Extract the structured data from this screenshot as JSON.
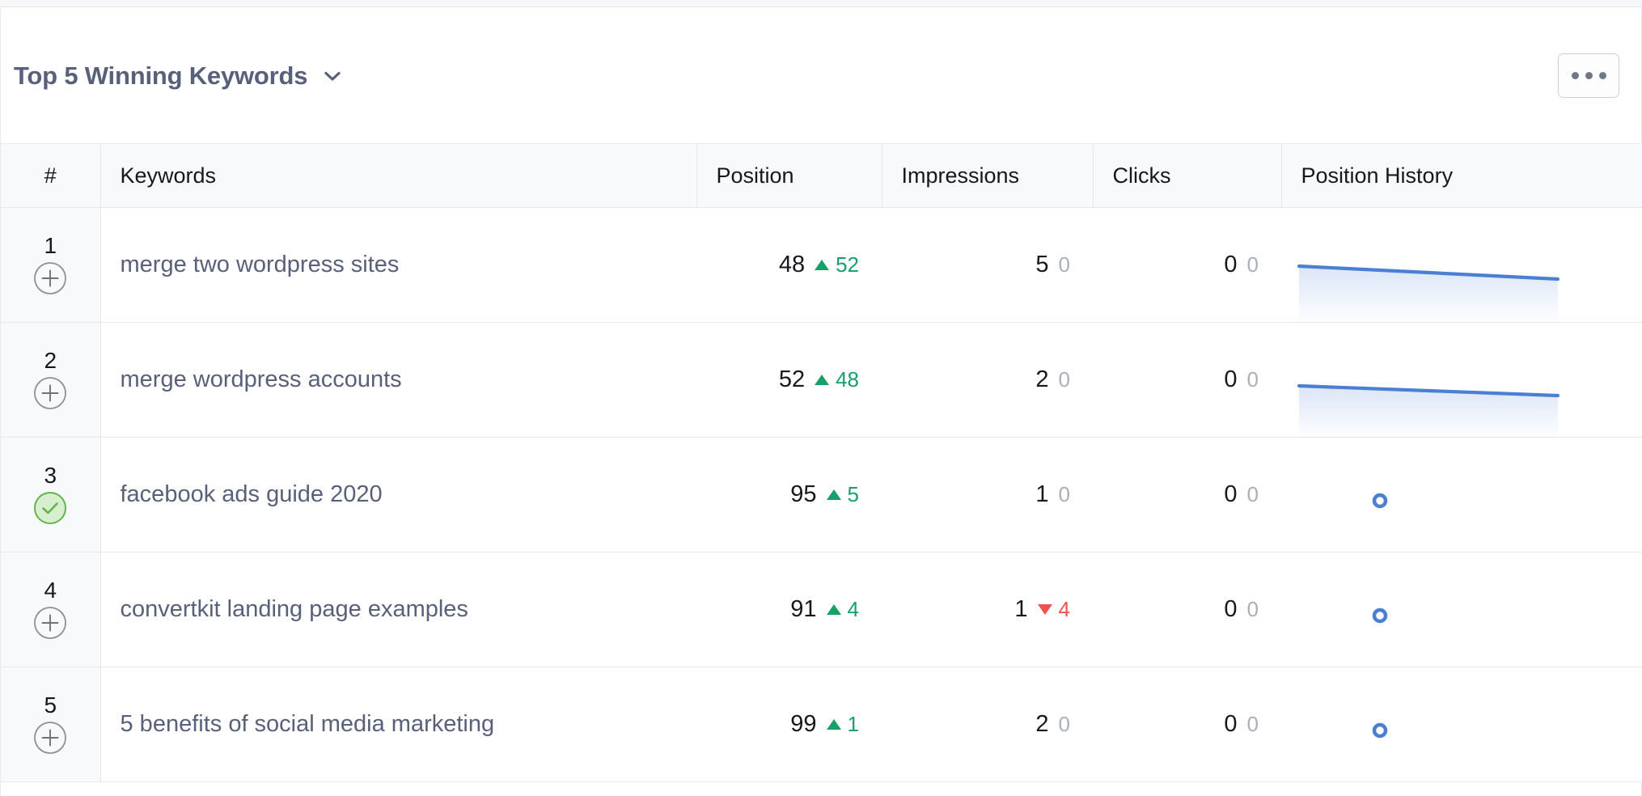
{
  "header": {
    "title": "Top 5 Winning Keywords",
    "dropdown_icon": "chevron-down-icon",
    "menu_button_label": "•••",
    "menu_button_icon": "ellipsis-icon"
  },
  "table": {
    "columns": [
      {
        "key": "num",
        "label": "#"
      },
      {
        "key": "kw",
        "label": "Keywords"
      },
      {
        "key": "pos",
        "label": "Position"
      },
      {
        "key": "impr",
        "label": "Impressions"
      },
      {
        "key": "clk",
        "label": "Clicks"
      },
      {
        "key": "hist",
        "label": "Position History"
      }
    ],
    "rows": [
      {
        "rank": "1",
        "action_icon": "plus-circle-icon",
        "action_state": "add",
        "keyword": "merge two wordpress sites",
        "position": "48",
        "position_delta": "52",
        "position_dir": "up",
        "impressions": "5",
        "impressions_delta": "0",
        "impressions_dir": "zero",
        "clicks": "0",
        "clicks_delta": "0",
        "clicks_dir": "zero",
        "history_type": "line"
      },
      {
        "rank": "2",
        "action_icon": "plus-circle-icon",
        "action_state": "add",
        "keyword": "merge wordpress accounts",
        "position": "52",
        "position_delta": "48",
        "position_dir": "up",
        "impressions": "2",
        "impressions_delta": "0",
        "impressions_dir": "zero",
        "clicks": "0",
        "clicks_delta": "0",
        "clicks_dir": "zero",
        "history_type": "line"
      },
      {
        "rank": "3",
        "action_icon": "check-circle-icon",
        "action_state": "added",
        "keyword": "facebook ads guide 2020",
        "position": "95",
        "position_delta": "5",
        "position_dir": "up",
        "impressions": "1",
        "impressions_delta": "0",
        "impressions_dir": "zero",
        "clicks": "0",
        "clicks_delta": "0",
        "clicks_dir": "zero",
        "history_type": "point"
      },
      {
        "rank": "4",
        "action_icon": "plus-circle-icon",
        "action_state": "add",
        "keyword": "convertkit landing page examples",
        "position": "91",
        "position_delta": "4",
        "position_dir": "up",
        "impressions": "1",
        "impressions_delta": "4",
        "impressions_dir": "down",
        "clicks": "0",
        "clicks_delta": "0",
        "clicks_dir": "zero",
        "history_type": "point"
      },
      {
        "rank": "5",
        "action_icon": "plus-circle-icon",
        "action_state": "add",
        "keyword": "5 benefits of social media marketing",
        "position": "99",
        "position_delta": "1",
        "position_dir": "up",
        "impressions": "2",
        "impressions_delta": "0",
        "impressions_dir": "zero",
        "clicks": "0",
        "clicks_delta": "0",
        "clicks_dir": "zero",
        "history_type": "point"
      }
    ]
  },
  "chart_data": {
    "type": "line",
    "title": "Position History",
    "description": "Per-row sparkline of keyword ranking position over time",
    "series": [
      {
        "name": "merge two wordpress sites",
        "render": "line",
        "x": [
          0,
          1
        ],
        "y": [
          48,
          52
        ]
      },
      {
        "name": "merge wordpress accounts",
        "render": "line",
        "x": [
          0,
          1
        ],
        "y": [
          52,
          55
        ]
      },
      {
        "name": "facebook ads guide 2020",
        "render": "point",
        "x": [
          0.27
        ],
        "y": [
          95
        ]
      },
      {
        "name": "convertkit landing page examples",
        "render": "point",
        "x": [
          0.27
        ],
        "y": [
          91
        ]
      },
      {
        "name": "5 benefits of social media marketing",
        "render": "point",
        "x": [
          0.27
        ],
        "y": [
          99
        ]
      }
    ],
    "line_color": "#4a7fd4",
    "point_color": "#4a7fd4",
    "grid": false,
    "legend": "none"
  },
  "colors": {
    "accent_blue": "#4a7fd4",
    "up_green": "#18a06b",
    "down_red": "#ef5350",
    "muted_gray": "#aab0b8",
    "title_slate": "#59617a",
    "header_bg": "#f8f9fa",
    "border": "#e5e8ec",
    "added_green_fill": "#d8efcf",
    "added_green_stroke": "#63b44b"
  }
}
